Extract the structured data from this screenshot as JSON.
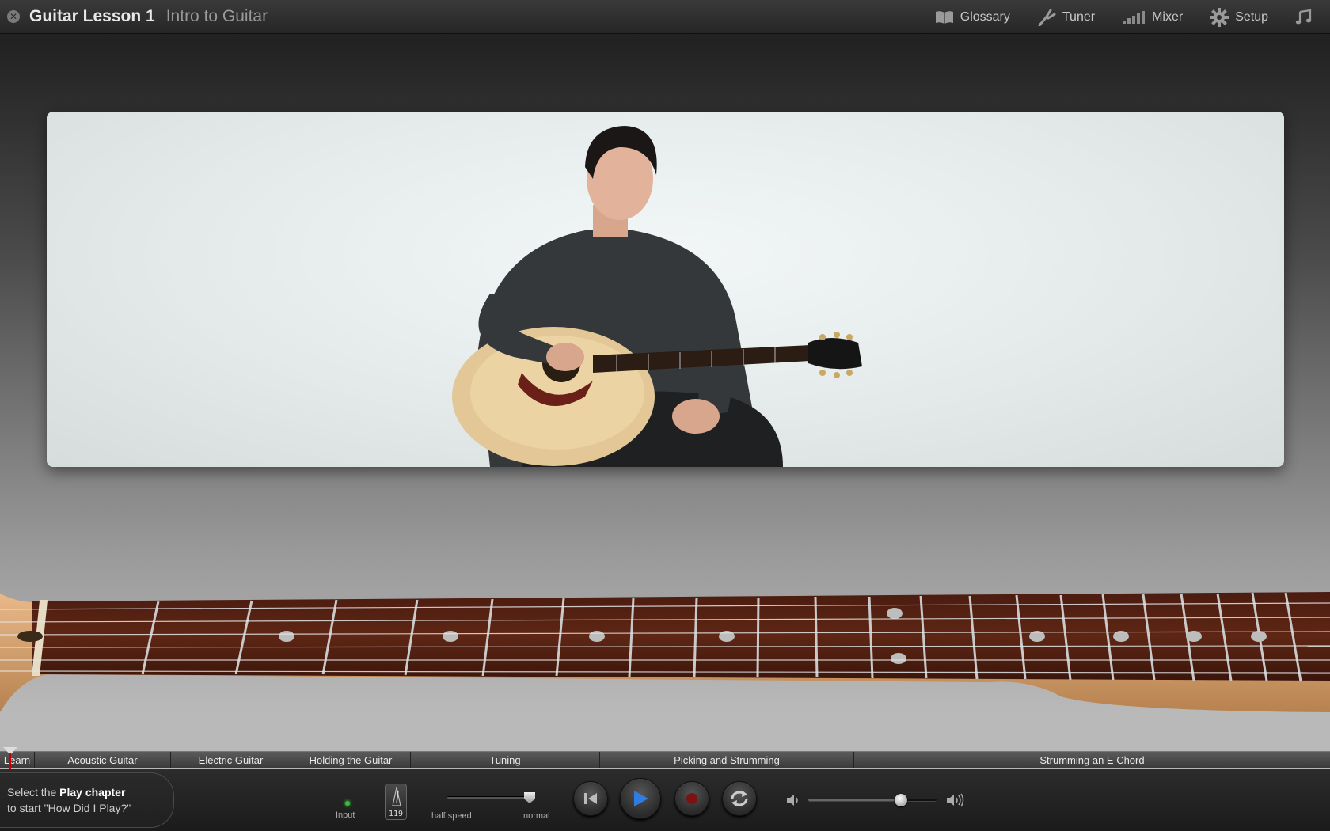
{
  "header": {
    "title": "Guitar Lesson 1",
    "subtitle": "Intro to Guitar",
    "buttons": [
      {
        "label": "Glossary",
        "icon": "book-icon"
      },
      {
        "label": "Tuner",
        "icon": "tuning-fork-icon"
      },
      {
        "label": "Mixer",
        "icon": "mixer-bars-icon"
      },
      {
        "label": "Setup",
        "icon": "gear-icon"
      },
      {
        "label": "",
        "icon": "music-note-icon"
      }
    ]
  },
  "chapters": [
    {
      "label": "Learn"
    },
    {
      "label": "Acoustic Guitar"
    },
    {
      "label": "Electric Guitar"
    },
    {
      "label": "Holding the Guitar"
    },
    {
      "label": "Tuning"
    },
    {
      "label": "Picking and Strumming"
    },
    {
      "label": "Strumming an E Chord"
    }
  ],
  "controls": {
    "hint_pre": "Select the ",
    "hint_bold": "Play chapter",
    "hint_post": "to start \"How Did I Play?\"",
    "input_label": "Input",
    "tempo": "119",
    "speed_left": "half speed",
    "speed_right": "normal",
    "speed_value": 1.0,
    "volume_value": 0.72
  },
  "colors": {
    "play_accent": "#2f7de1",
    "record": "#7a1414",
    "input_led": "#3dbb3d"
  }
}
